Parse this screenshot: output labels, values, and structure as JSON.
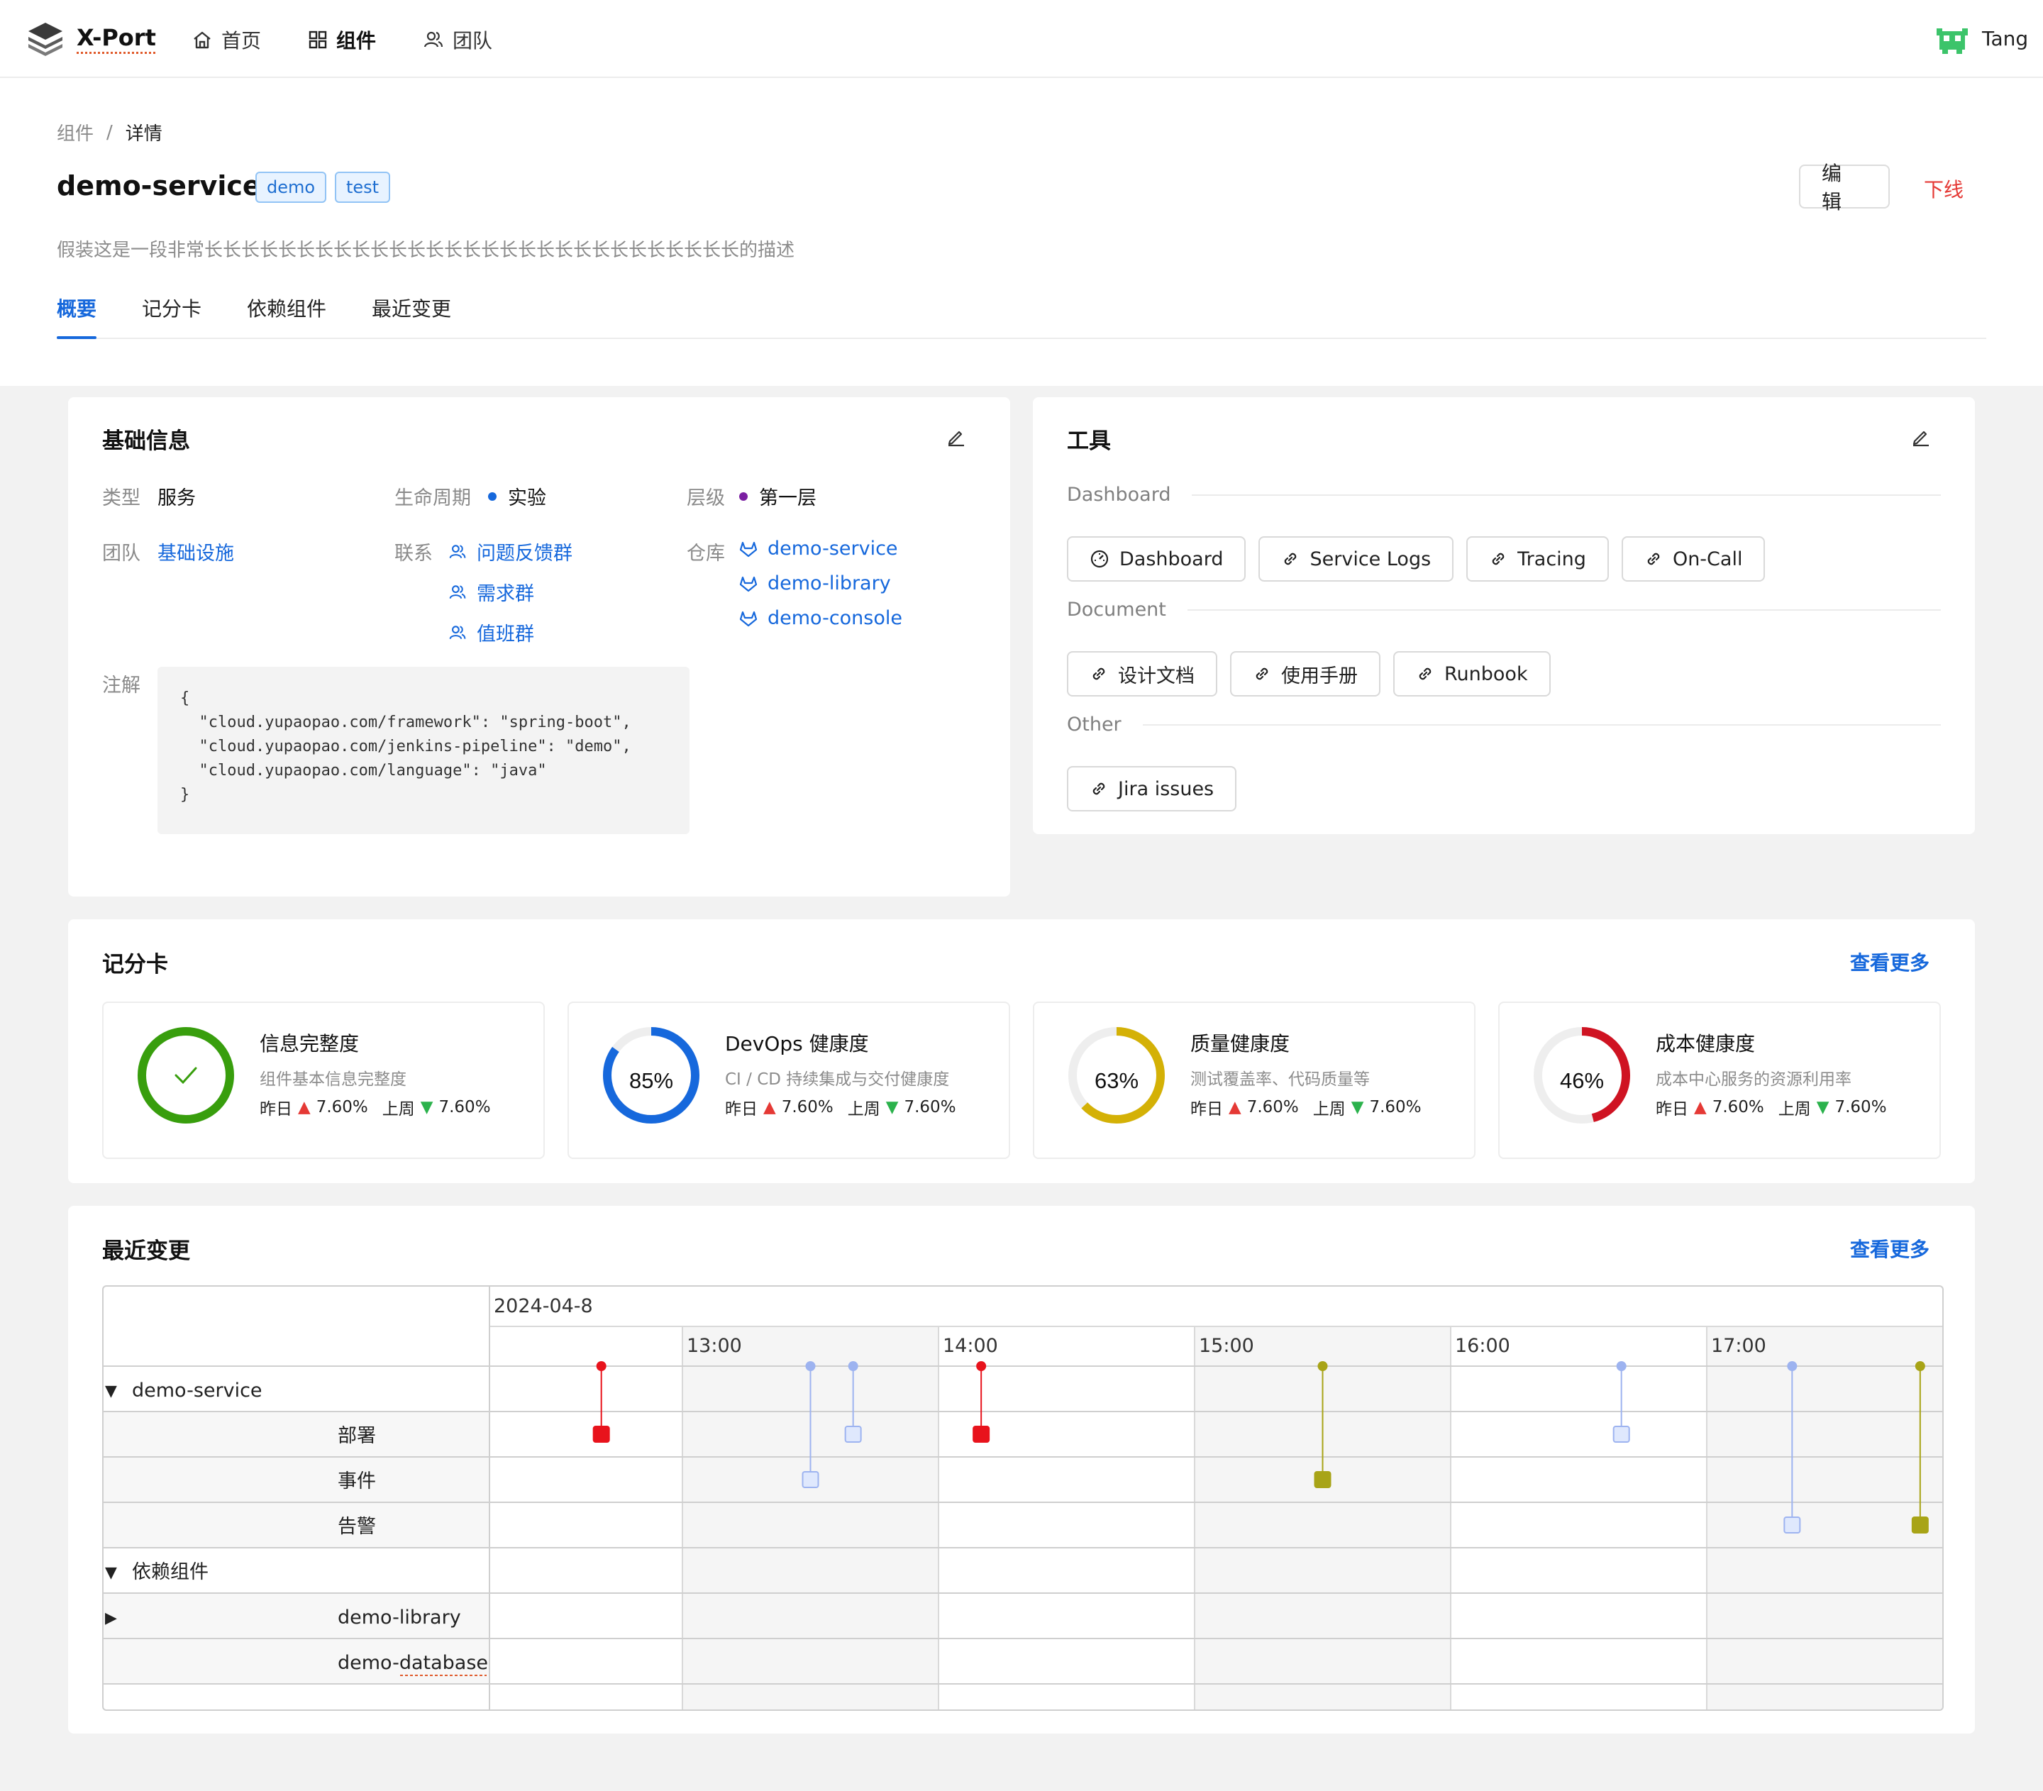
{
  "app": {
    "name": "X-Port",
    "user": "Tang"
  },
  "nav": [
    {
      "label": "首页",
      "icon": "home-icon"
    },
    {
      "label": "组件",
      "icon": "grid-icon"
    },
    {
      "label": "团队",
      "icon": "team-icon"
    }
  ],
  "breadcrumb": {
    "parent": "组件",
    "separator": "/",
    "current": "详情"
  },
  "component": {
    "name": "demo-service",
    "tags": [
      "demo",
      "test"
    ],
    "description": "假装这是一段非常长长长长长长长长长长长长长长长长长长长长长长长长长长长长长的描述",
    "edit_label": "编 辑",
    "offline_label": "下线"
  },
  "tabs": [
    "概要",
    "记分卡",
    "依赖组件",
    "最近变更"
  ],
  "basic_info": {
    "title": "基础信息",
    "type_label": "类型",
    "type_value": "服务",
    "lifecycle_label": "生命周期",
    "lifecycle_value": "实验",
    "tier_label": "层级",
    "tier_value": "第一层",
    "team_label": "团队",
    "team_value": "基础设施",
    "contact_label": "联系",
    "contacts": [
      "问题反馈群",
      "需求群",
      "值班群"
    ],
    "repo_label": "仓库",
    "repos": [
      "demo-service",
      "demo-library",
      "demo-console"
    ],
    "annotation_label": "注解",
    "annotation": "{\n  \"cloud.yupaopao.com/framework\": \"spring-boot\",\n  \"cloud.yupaopao.com/jenkins-pipeline\": \"demo\",\n  \"cloud.yupaopao.com/language\": \"java\"\n}",
    "colors": {
      "lifecycle_dot": "#1668dc",
      "tier_dot": "#7b1fa2"
    }
  },
  "tools": {
    "title": "工具",
    "groups": [
      {
        "label": "Dashboard",
        "items": [
          {
            "label": "Dashboard",
            "icon": "gauge-icon"
          },
          {
            "label": "Service Logs",
            "icon": "link-icon"
          },
          {
            "label": "Tracing",
            "icon": "link-icon"
          },
          {
            "label": "On-Call",
            "icon": "link-icon"
          }
        ]
      },
      {
        "label": "Document",
        "items": [
          {
            "label": "设计文档",
            "icon": "link-icon"
          },
          {
            "label": "使用手册",
            "icon": "link-icon"
          },
          {
            "label": "Runbook",
            "icon": "link-icon"
          }
        ]
      },
      {
        "label": "Other",
        "items": [
          {
            "label": "Jira issues",
            "icon": "link-icon"
          }
        ]
      }
    ]
  },
  "scorecard": {
    "title": "记分卡",
    "more": "查看更多",
    "yesterday_label": "昨日",
    "last_week_label": "上周",
    "items": [
      {
        "title": "信息完整度",
        "subtitle": "组件基本信息完整度",
        "percent": 100,
        "display": "",
        "complete": true,
        "color": "#389e0d",
        "yesterday": "7.60%",
        "last_week": "7.60%"
      },
      {
        "title": "DevOps 健康度",
        "subtitle": "CI / CD 持续集成与交付健康度",
        "percent": 85,
        "display": "85%",
        "color": "#1668dc",
        "yesterday": "7.60%",
        "last_week": "7.60%"
      },
      {
        "title": "质量健康度",
        "subtitle": "测试覆盖率、代码质量等",
        "percent": 63,
        "display": "63%",
        "color": "#d4b106",
        "yesterday": "7.60%",
        "last_week": "7.60%"
      },
      {
        "title": "成本健康度",
        "subtitle": "成本中心服务的资源利用率",
        "percent": 46,
        "display": "46%",
        "color": "#cf1322",
        "yesterday": "7.60%",
        "last_week": "7.60%"
      }
    ]
  },
  "changes": {
    "title": "最近变更",
    "more": "查看更多",
    "date": "2024-04-8",
    "hours": [
      "13:00",
      "14:00",
      "15:00",
      "16:00",
      "17:00"
    ],
    "rows": [
      {
        "label": "demo-service",
        "toggle": "▼",
        "level": 0
      },
      {
        "label": "部署",
        "level": 1
      },
      {
        "label": "事件",
        "level": 1
      },
      {
        "label": "告警",
        "level": 1
      },
      {
        "label": "依赖组件",
        "toggle": "▼",
        "level": 0
      },
      {
        "label": "demo-library",
        "toggle": "▶",
        "level": 1
      },
      {
        "label": "demo-database",
        "level": 1
      }
    ],
    "events": [
      {
        "time": "12:41",
        "row": 1,
        "color": "#e8131c"
      },
      {
        "time": "13:30",
        "row": 2,
        "color": "#a9bff5"
      },
      {
        "time": "13:40",
        "row": 1,
        "color": "#a9bff5"
      },
      {
        "time": "14:10",
        "row": 1,
        "color": "#e8131c"
      },
      {
        "time": "15:30",
        "row": 2,
        "color": "#a8a417"
      },
      {
        "time": "16:40",
        "row": 1,
        "color": "#a9bff5"
      },
      {
        "time": "17:20",
        "row": 3,
        "color": "#a9bff5"
      },
      {
        "time": "17:50",
        "row": 3,
        "color": "#a8a417"
      }
    ]
  }
}
